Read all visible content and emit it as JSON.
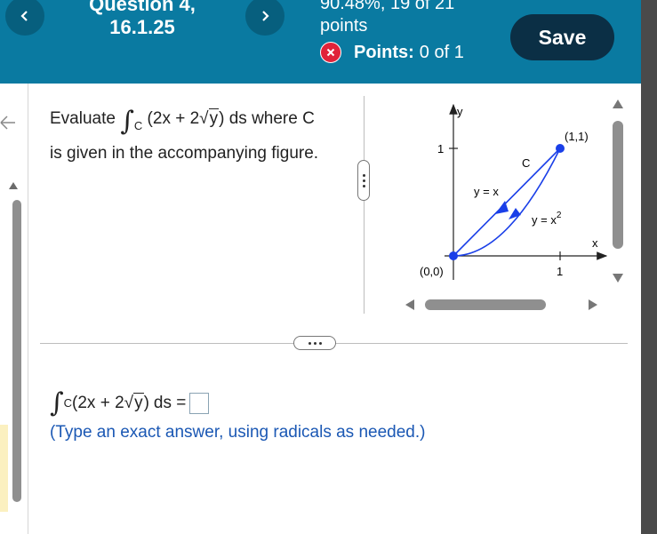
{
  "header": {
    "question_title_line1": "Question 4,",
    "question_title_line2": "16.1.25",
    "score_percent": "90.48%, 19 of 21",
    "score_unit": "points",
    "points_label": "Points:",
    "points_value": "0 of 1",
    "save_label": "Save"
  },
  "question": {
    "prefix": "Evaluate",
    "integral_symbol": "∫",
    "subscript": "C",
    "integrand_start": "(2x + 2",
    "sqrt_arg": "y",
    "integrand_end": ")",
    "ds_where": "ds where C",
    "line2": "is given in the accompanying figure."
  },
  "figure": {
    "y_axis_label": "y",
    "x_axis_label": "x",
    "y_tick": "1",
    "x_tick": "1",
    "origin_label": "(0,0)",
    "end_point_label": "(1,1)",
    "curve_label": "C",
    "line_label": "y = x",
    "parabola_label_base": "y = x",
    "parabola_label_exp": "2",
    "accent_color": "#1a3fe8"
  },
  "answer": {
    "integral_symbol": "∫",
    "subscript": "C",
    "integrand_start": "(2x + 2",
    "sqrt_arg": "y",
    "integrand_end": ")",
    "ds_equals": "ds =",
    "input_value": "",
    "instruction": "(Type an exact answer, using radicals as needed.)"
  },
  "colors": {
    "header_bg": "#0a7aa1",
    "nav_button_bg": "#075f7e",
    "save_button_bg": "#0b2f45",
    "error_icon": "#e0233a",
    "instruction_text": "#1b58b4"
  }
}
